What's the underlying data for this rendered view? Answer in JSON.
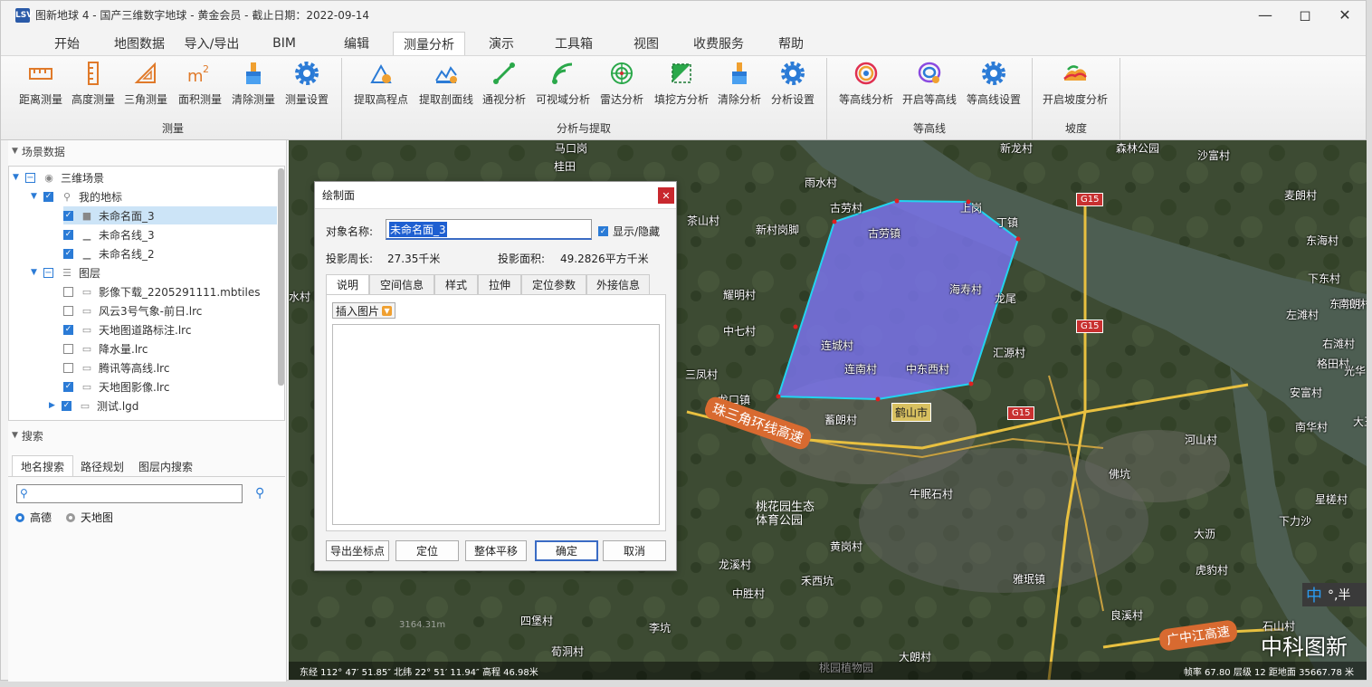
{
  "window": {
    "title": "图新地球 4 - 国产三维数字地球 - 黄金会员 - 截止日期：2022-09-14",
    "logo": "LSV"
  },
  "menu": {
    "tabs": [
      "开始",
      "地图数据",
      "导入/导出",
      "BIM",
      "编辑",
      "测量分析",
      "演示",
      "工具箱",
      "视图",
      "收费服务",
      "帮助"
    ],
    "active": "测量分析"
  },
  "ribbon": {
    "groups": [
      {
        "label": "测量",
        "buttons": [
          "距离测量",
          "高度测量",
          "三角测量",
          "面积测量",
          "清除测量",
          "测量设置"
        ]
      },
      {
        "label": "分析与提取",
        "buttons": [
          "提取高程点",
          "提取剖面线",
          "通视分析",
          "可视域分析",
          "雷达分析",
          "填挖方分析",
          "清除分析",
          "分析设置"
        ]
      },
      {
        "label": "等高线",
        "buttons": [
          "等高线分析",
          "开启等高线",
          "等高线设置"
        ]
      },
      {
        "label": "坡度",
        "buttons": [
          "开启坡度分析"
        ]
      }
    ]
  },
  "scene_panel": {
    "header": "场景数据",
    "root": "三维场景",
    "landmarks": "我的地标",
    "landmark_items": [
      "未命名面_3",
      "未命名线_3",
      "未命名线_2"
    ],
    "layers": "图层",
    "layer_items": [
      "影像下载_2205291111.mbtiles",
      "风云3号气象-前日.lrc",
      "天地图道路标注.lrc",
      "降水量.lrc",
      "腾讯等高线.lrc",
      "天地图影像.lrc",
      "测试.lgd"
    ]
  },
  "search_panel": {
    "header": "搜索",
    "tabs": [
      "地名搜索",
      "路径规划",
      "图层内搜索"
    ],
    "placeholder": "",
    "radios": [
      "高德",
      "天地图"
    ]
  },
  "map": {
    "labels": [
      {
        "t": "马口岗"
      },
      {
        "t": "桂田"
      },
      {
        "t": "雨水村"
      },
      {
        "t": "茶山村"
      },
      {
        "t": "新村岗脚"
      },
      {
        "t": "古劳村"
      },
      {
        "t": "古劳镇"
      },
      {
        "t": "新龙村"
      },
      {
        "t": "森林公园"
      },
      {
        "t": "沙富村"
      },
      {
        "t": "麦朗村"
      },
      {
        "t": "东海村"
      },
      {
        "t": "海寿村"
      },
      {
        "t": "龙尾"
      },
      {
        "t": "下东村"
      },
      {
        "t": "东冲村"
      },
      {
        "t": "南朗村"
      },
      {
        "t": "左滩村"
      },
      {
        "t": "右滩村"
      },
      {
        "t": "耀明村"
      },
      {
        "t": "中七村"
      },
      {
        "t": "连城村"
      },
      {
        "t": "三凤村"
      },
      {
        "t": "连南村"
      },
      {
        "t": "中东西村"
      },
      {
        "t": "汇源村"
      },
      {
        "t": "格田村"
      },
      {
        "t": "安富村"
      },
      {
        "t": "光华"
      },
      {
        "t": "龙口镇"
      },
      {
        "t": "蓄朗村"
      },
      {
        "t": "鹤山市"
      },
      {
        "t": "南华村"
      },
      {
        "t": "大王"
      },
      {
        "t": "河山村"
      },
      {
        "t": "佛坑"
      },
      {
        "t": "牛眠石村"
      },
      {
        "t": "星槎村"
      },
      {
        "t": "下力沙"
      },
      {
        "t": "大沥"
      },
      {
        "t": "黄岗村"
      },
      {
        "t": "虎豹村"
      },
      {
        "t": "龙溪村"
      },
      {
        "t": "禾西坑"
      },
      {
        "t": "雅珉镇"
      },
      {
        "t": "中胜村"
      },
      {
        "t": "四堡村"
      },
      {
        "t": "李坑"
      },
      {
        "t": "良溪村"
      },
      {
        "t": "石山村"
      },
      {
        "t": "荀洞村"
      },
      {
        "t": "大朗村"
      },
      {
        "t": "桃园植物园"
      },
      {
        "t": "水村"
      },
      {
        "t": "上岗"
      },
      {
        "t": "丁镇"
      }
    ],
    "road_labels": [
      "珠三角环线高速",
      "广中江高速"
    ],
    "park_label": "桃花园生态体育公园",
    "highway_shields": [
      "G15",
      "G15",
      "G15"
    ],
    "elevation_mark": "3164.31m",
    "city_badge": "鹤山市",
    "watermark": "中科图新",
    "ime": [
      "中",
      "°,半"
    ],
    "status_left": "东经 112° 47′ 51.85″ 北纬 22° 51′ 11.94″  高程 46.98米",
    "status_right": "帧率 67.80  层级 12  距地面 35667.78 米",
    "polygon_color": "#7b74f0",
    "polygon_stroke": "#22d4f0"
  },
  "dialog": {
    "title": "绘制面",
    "name_label": "对象名称:",
    "name_value": "未命名面_3",
    "show_hide": "显示/隐藏",
    "perimeter_label": "投影周长:",
    "perimeter_value": "27.35千米",
    "area_label": "投影面积:",
    "area_value": "49.2826平方千米",
    "tabs": [
      "说明",
      "空间信息",
      "样式",
      "拉伸",
      "定位参数",
      "外接信息"
    ],
    "insert_image": "插入图片",
    "buttons": [
      "导出坐标点",
      "定位",
      "整体平移",
      "确定",
      "取消"
    ]
  }
}
